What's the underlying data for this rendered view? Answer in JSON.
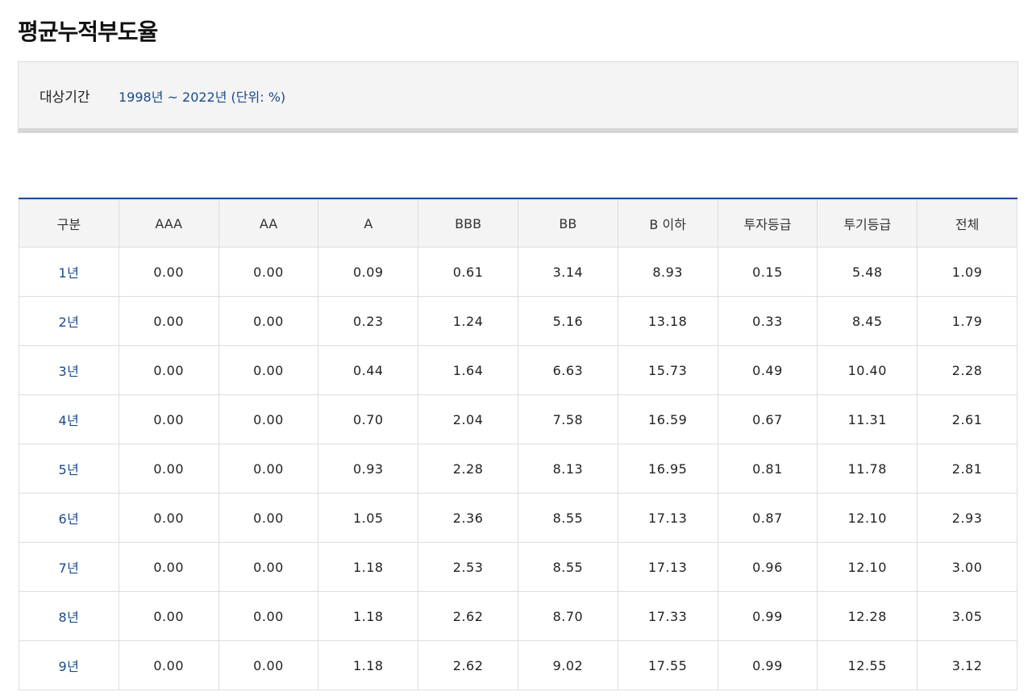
{
  "page": {
    "title": "평균누적부도율"
  },
  "period": {
    "label": "대상기간",
    "value": "1998년 ~ 2022년 (단위: %)"
  },
  "table": {
    "headers": [
      "구분",
      "AAA",
      "AA",
      "A",
      "BBB",
      "BB",
      "B 이하",
      "투자등급",
      "투기등급",
      "전체"
    ],
    "rows": [
      {
        "label": "1년",
        "values": [
          "0.00",
          "0.00",
          "0.09",
          "0.61",
          "3.14",
          "8.93",
          "0.15",
          "5.48",
          "1.09"
        ]
      },
      {
        "label": "2년",
        "values": [
          "0.00",
          "0.00",
          "0.23",
          "1.24",
          "5.16",
          "13.18",
          "0.33",
          "8.45",
          "1.79"
        ]
      },
      {
        "label": "3년",
        "values": [
          "0.00",
          "0.00",
          "0.44",
          "1.64",
          "6.63",
          "15.73",
          "0.49",
          "10.40",
          "2.28"
        ]
      },
      {
        "label": "4년",
        "values": [
          "0.00",
          "0.00",
          "0.70",
          "2.04",
          "7.58",
          "16.59",
          "0.67",
          "11.31",
          "2.61"
        ]
      },
      {
        "label": "5년",
        "values": [
          "0.00",
          "0.00",
          "0.93",
          "2.28",
          "8.13",
          "16.95",
          "0.81",
          "11.78",
          "2.81"
        ]
      },
      {
        "label": "6년",
        "values": [
          "0.00",
          "0.00",
          "1.05",
          "2.36",
          "8.55",
          "17.13",
          "0.87",
          "12.10",
          "2.93"
        ]
      },
      {
        "label": "7년",
        "values": [
          "0.00",
          "0.00",
          "1.18",
          "2.53",
          "8.55",
          "17.13",
          "0.96",
          "12.10",
          "3.00"
        ]
      },
      {
        "label": "8년",
        "values": [
          "0.00",
          "0.00",
          "1.18",
          "2.62",
          "8.70",
          "17.33",
          "0.99",
          "12.28",
          "3.05"
        ]
      },
      {
        "label": "9년",
        "values": [
          "0.00",
          "0.00",
          "1.18",
          "2.62",
          "9.02",
          "17.55",
          "0.99",
          "12.55",
          "3.12"
        ]
      }
    ]
  },
  "colors": {
    "accent": "#1f4e96",
    "link_text": "#1a4a8a",
    "header_bg": "#f4f4f4",
    "border": "#dddddd"
  }
}
